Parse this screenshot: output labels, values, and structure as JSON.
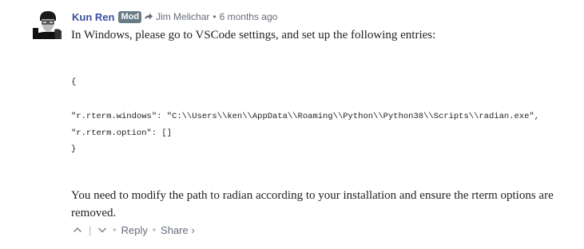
{
  "comment": {
    "author": "Kun Ren",
    "badge": "Mod",
    "parent_author": "Jim Melichar",
    "timestamp": "6 months ago",
    "intro": "In Windows, please go to VSCode settings, and set up the following entries:",
    "code": {
      "open": "{",
      "line1": "\"r.rterm.windows\": \"C:\\\\Users\\\\ken\\\\AppData\\\\Roaming\\\\Python\\\\Python38\\\\Scripts\\\\radian.exe\",",
      "line2": "\"r.rterm.option\": []",
      "close": "}"
    },
    "outro": "You need to modify the path to radian according to your installation and ensure the rterm options are removed."
  },
  "footer": {
    "separator": "|",
    "dot": "•",
    "reply_label": "Reply",
    "share_label": "Share ›"
  },
  "icons": {
    "avatar": "avatar-photo",
    "reply_arrow": "reply-arrow-icon",
    "upvote": "chevron-up-icon",
    "downvote": "chevron-down-icon"
  },
  "colors": {
    "author": "#3a4fa0",
    "badge_bg": "#687a86",
    "meta_text": "#656c7a"
  }
}
